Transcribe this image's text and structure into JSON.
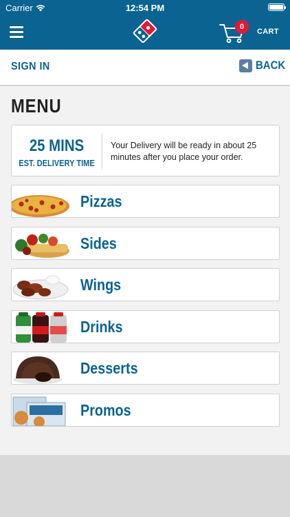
{
  "status": {
    "carrier": "Carrier",
    "time": "12:54 PM"
  },
  "header": {
    "cart_count": "0",
    "cart_label": "CART"
  },
  "subbar": {
    "signin": "SIGN IN",
    "back": "BACK"
  },
  "page": {
    "title": "MENU"
  },
  "delivery": {
    "mins": "25 MINS",
    "est": "EST. DELIVERY TIME",
    "message": "Your Delivery will be ready in about 25 minutes after you place your order."
  },
  "menu": {
    "items": [
      {
        "label": "Pizzas",
        "icon": "pizza-icon"
      },
      {
        "label": "Sides",
        "icon": "sides-icon"
      },
      {
        "label": "Wings",
        "icon": "wings-icon"
      },
      {
        "label": "Drinks",
        "icon": "drinks-icon"
      },
      {
        "label": "Desserts",
        "icon": "dessert-icon"
      },
      {
        "label": "Promos",
        "icon": "promo-icon"
      }
    ]
  },
  "colors": {
    "brand": "#0b6392",
    "badge": "#e31837",
    "background": "#f2f2f2"
  }
}
